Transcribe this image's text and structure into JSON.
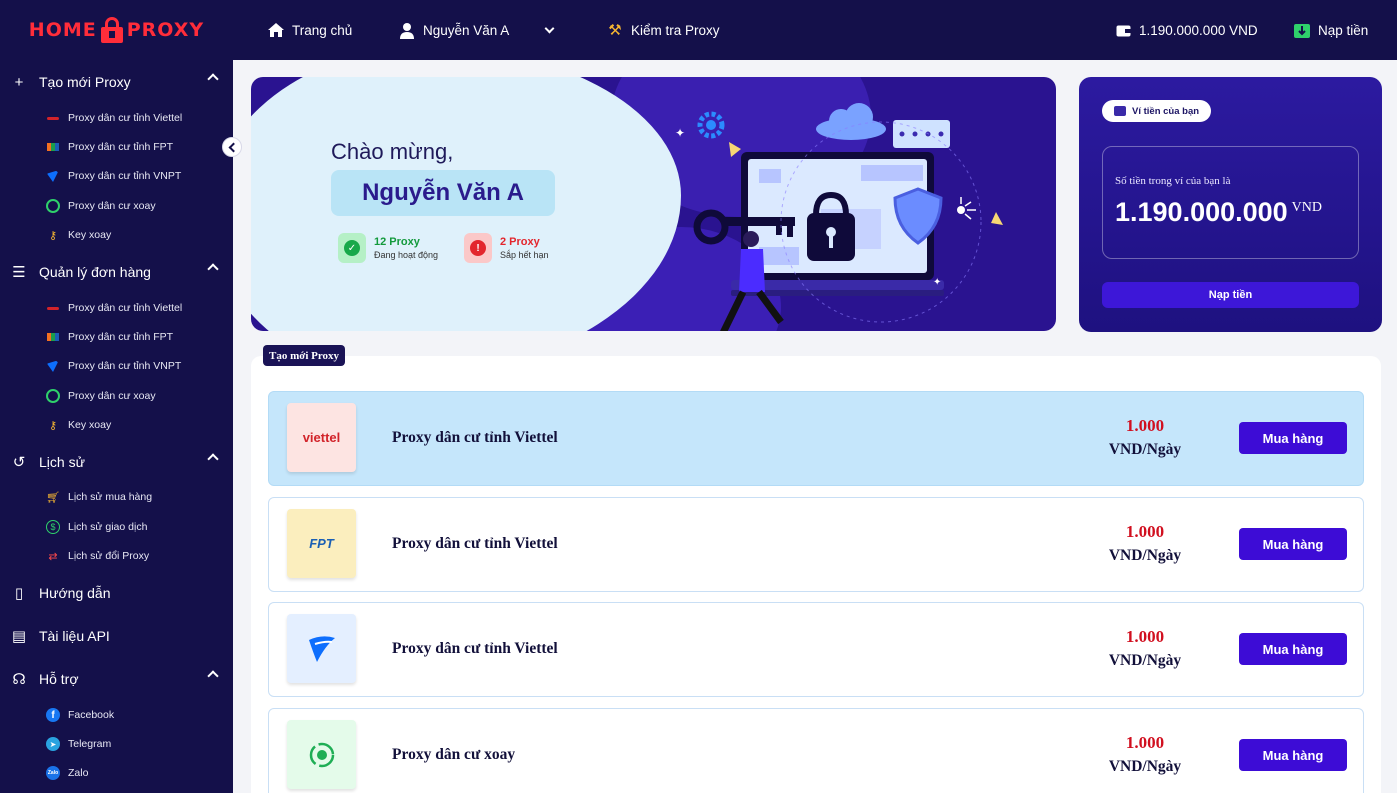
{
  "brand": {
    "logo_left": "HOME",
    "logo_right": "PROXY",
    "accent": "#ff2d3a",
    "sidebar_bg": "#14104a"
  },
  "topbar": {
    "home": "Trang chủ",
    "user": "Nguyễn Văn A",
    "check_proxy": "Kiểm tra Proxy",
    "balance": "1.190.000.000 VND",
    "topup": "Nạp tiền"
  },
  "sidebar": {
    "sections": [
      {
        "label": "Tạo mới Proxy",
        "icon": "plus-icon",
        "items": [
          {
            "label": "Proxy dân cư tỉnh Viettel",
            "icon": "viettel-icon"
          },
          {
            "label": "Proxy dân cư tỉnh FPT",
            "icon": "fpt-icon"
          },
          {
            "label": "Proxy dân cư tỉnh VNPT",
            "icon": "vnpt-icon"
          },
          {
            "label": "Proxy dân cư xoay",
            "icon": "rotate-icon"
          },
          {
            "label": "Key xoay",
            "icon": "key-icon"
          }
        ]
      },
      {
        "label": "Quản lý đơn hàng",
        "icon": "list-icon",
        "items": [
          {
            "label": "Proxy dân cư tỉnh Viettel",
            "icon": "viettel-icon"
          },
          {
            "label": "Proxy dân cư tỉnh FPT",
            "icon": "fpt-icon"
          },
          {
            "label": "Proxy dân cư tỉnh VNPT",
            "icon": "vnpt-icon"
          },
          {
            "label": "Proxy dân cư xoay",
            "icon": "rotate-icon"
          },
          {
            "label": "Key xoay",
            "icon": "key-icon"
          }
        ]
      },
      {
        "label": "Lịch sử",
        "icon": "history-icon",
        "items": [
          {
            "label": "Lịch sử mua hàng",
            "icon": "cart-icon"
          },
          {
            "label": "Lịch sử giao dịch",
            "icon": "dollar-icon"
          },
          {
            "label": "Lịch sử đổi Proxy",
            "icon": "swap-icon"
          }
        ]
      },
      {
        "label": "Hướng dẫn",
        "icon": "book-icon",
        "items": []
      },
      {
        "label": "Tài liệu API",
        "icon": "file-code-icon",
        "items": []
      },
      {
        "label": "Hỗ trợ",
        "icon": "headset-icon",
        "items": [
          {
            "label": "Facebook",
            "icon": "facebook-icon"
          },
          {
            "label": "Telegram",
            "icon": "telegram-icon"
          },
          {
            "label": "Zalo",
            "icon": "zalo-icon"
          }
        ]
      }
    ]
  },
  "banner": {
    "welcome": "Chào mừng,",
    "name": "Nguyễn Văn A",
    "stat_active_count": "12 Proxy",
    "stat_active_label": "Đang hoạt động",
    "stat_expiring_count": "2 Proxy",
    "stat_expiring_label": "Sắp hết hạn"
  },
  "wallet": {
    "pill": "Ví tiền của bạn",
    "label": "Số tiền trong ví của bạn là",
    "amount": "1.190.000.000",
    "currency": "VND",
    "button": "Nạp tiền"
  },
  "products": {
    "tag": "Tạo mới Proxy",
    "rows": [
      {
        "name": "Proxy dân cư tỉnh Viettel",
        "logo": "viettel",
        "price": "1.000",
        "unit": "VND/Ngày",
        "button": "Mua hàng"
      },
      {
        "name": "Proxy dân cư tỉnh Viettel",
        "logo": "FPT",
        "price": "1.000",
        "unit": "VND/Ngày",
        "button": "Mua hàng"
      },
      {
        "name": "Proxy dân cư tỉnh Viettel",
        "logo": "vnpt",
        "price": "1.000",
        "unit": "VND/Ngày",
        "button": "Mua hàng"
      },
      {
        "name": "Proxy dân cư xoay",
        "logo": "rotate",
        "price": "1.000",
        "unit": "VND/Ngày",
        "button": "Mua hàng"
      }
    ]
  }
}
